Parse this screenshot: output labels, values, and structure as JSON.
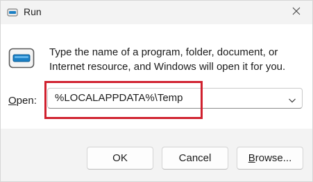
{
  "window": {
    "title": "Run",
    "icons": {
      "app": "run-icon",
      "close": "close-icon",
      "dropdown": "chevron-down-icon"
    }
  },
  "dialog": {
    "message": "Type the name of a program, folder, document, or Internet resource, and Windows will open it for you.",
    "open_label_accel": "O",
    "open_label_rest": "pen:",
    "open_value": "%LOCALAPPDATA%\\Temp"
  },
  "buttons": {
    "ok": "OK",
    "cancel": "Cancel",
    "browse_accel": "B",
    "browse_rest": "rowse..."
  },
  "colors": {
    "highlight": "#d0202e",
    "footer_bg": "#f3f3f3",
    "icon_accent": "#1a7fc4"
  }
}
